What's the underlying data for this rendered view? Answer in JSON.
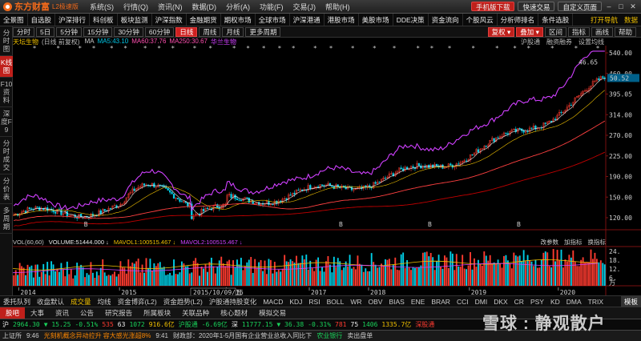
{
  "app": {
    "logo_name": "东方财富",
    "edition": "L2极速版"
  },
  "menu": {
    "items": [
      "系统(S)",
      "行情(Q)",
      "资讯(N)",
      "数据(D)",
      "分析(A)",
      "功能(F)",
      "交易(J)",
      "帮助(H)"
    ]
  },
  "title_right": {
    "mobile": "手机版下载",
    "quick_trade": "快速交易",
    "custom_page": "自定义页面"
  },
  "nav": {
    "items": [
      "全景图",
      "自选股",
      "沪深排行",
      "科创板",
      "板块监测",
      "沪深指数",
      "金融期货",
      "期权市场",
      "全球市场",
      "沪深港通",
      "港股市场",
      "美股市场",
      "DDE决策",
      "资金流向",
      "个股风云",
      "分析师排名",
      "条件选股"
    ],
    "right": [
      "打开导航",
      "数据"
    ]
  },
  "periods": {
    "items": [
      "分时",
      "5日",
      "5分钟",
      "15分钟",
      "30分钟",
      "60分钟",
      "日线",
      "周线",
      "月线",
      "更多周期"
    ],
    "active": "日线"
  },
  "period_right": {
    "red": [
      "复权",
      "叠加"
    ],
    "plain": [
      "区间",
      "指标",
      "画线",
      "帮助"
    ]
  },
  "rail": {
    "items": [
      "分时图",
      "K线图",
      "F10资料",
      "深度F9",
      "分时成交",
      "分价表",
      "多周期"
    ],
    "active": "K线图"
  },
  "chart_head": {
    "symbol": "天坛生物",
    "sub": "(日线 前复权)",
    "mas": [
      {
        "text": "MA",
        "color": "#cccccc"
      },
      {
        "text": "MA5:43.10",
        "color": "#00c8e8"
      },
      {
        "text": "MA60:37.76",
        "color": "#ff4fb0"
      },
      {
        "text": "MA250:30.67",
        "color": "#ff4fb0"
      },
      {
        "text": "华兰生物",
        "color": "#d040ff"
      }
    ],
    "right": [
      "沪股通",
      "融资融券",
      "设置均线"
    ]
  },
  "price_axis": {
    "ticks": [
      "540.00",
      "460.00",
      "395.05",
      "314.00",
      "270.00",
      "225.00",
      "190.00",
      "150.00",
      "120.00"
    ],
    "last": "50.52",
    "annot": "46.65"
  },
  "vol_head": {
    "items": [
      {
        "text": "VOL(60,60)",
        "color": "#cccccc"
      },
      {
        "text": "VOLUME:51444.000 ↓",
        "color": "#eeeeee"
      },
      {
        "text": "MAVOL1:100515.467 ↓",
        "color": "#f0c000"
      },
      {
        "text": "MAVOL2:100515.467 ↓",
        "color": "#d040ff"
      }
    ],
    "right": [
      "改参数",
      "加指标",
      "换指标"
    ]
  },
  "vol_axis": {
    "ticks": [
      "24.",
      "18.",
      "12.",
      "6."
    ],
    "unit": "万"
  },
  "time_axis": {
    "years": [
      "2014",
      "2015",
      "2016",
      "2017",
      "2018",
      "2019",
      "2020"
    ],
    "cursor": "2015/10/09/五"
  },
  "indicator_tabs": {
    "items": [
      "委托队列",
      "收盘默认",
      "成交量",
      "均线",
      "资金博弈(L2)",
      "资金趋势(L2)",
      "沪股通持股变化",
      "MACD",
      "KDJ",
      "RSI",
      "BOLL",
      "WR",
      "OBV",
      "BIAS",
      "ENE",
      "BRAR",
      "CCI",
      "DMI",
      "DKX",
      "CR",
      "PSY",
      "KD",
      "DMA",
      "TRIX"
    ],
    "active": "成交量",
    "template": "模板"
  },
  "news_tabs": {
    "items": [
      "股吧",
      "大事",
      "资讯",
      "公告",
      "研究报告",
      "所属板块",
      "关联品种",
      "核心题材",
      "模拟交易"
    ],
    "active": "股吧"
  },
  "quotes": [
    {
      "text": "沪",
      "color": "#eeeeee"
    },
    {
      "text": "2964.30",
      "color": "#19d25a"
    },
    {
      "text": "▼ 15.25",
      "color": "#19d25a"
    },
    {
      "text": "-0.51%",
      "color": "#19d25a"
    },
    {
      "text": "535",
      "color": "#ff3b30"
    },
    {
      "text": "63",
      "color": "#eeeeee"
    },
    {
      "text": "1072",
      "color": "#19d25a"
    },
    {
      "text": "916.6亿",
      "color": "#f0c000"
    },
    {
      "text": "沪股通",
      "color": "#19d25a"
    },
    {
      "text": "-6.69亿",
      "color": "#19d25a"
    },
    {
      "text": "深",
      "color": "#eeeeee"
    },
    {
      "text": "11777.15",
      "color": "#19d25a"
    },
    {
      "text": "▼ 36.38",
      "color": "#19d25a"
    },
    {
      "text": "-0.31%",
      "color": "#19d25a"
    },
    {
      "text": "781",
      "color": "#ff3b30"
    },
    {
      "text": "75",
      "color": "#eeeeee"
    },
    {
      "text": "1406",
      "color": "#19d25a"
    },
    {
      "text": "1335.7亿",
      "color": "#f0c000"
    },
    {
      "text": "深股通",
      "color": "#ff3b30"
    }
  ],
  "status": {
    "market": "上证所",
    "t1": "9:46",
    "news1": "光刻机概念异动拉升 容大感光涨超8%",
    "t2": "9:41",
    "news2": "财政部：2020年1-5月国有企业营业总收入同比下",
    "stock": "农业银行",
    "action": "卖出盘单"
  },
  "watermark": "雪球 : 静观散户",
  "colors": {
    "accent_red": "#c0201b",
    "logo_orange": "#f26a1b",
    "ma_yellow": "#f0c000",
    "cyan": "#00c8e8",
    "purple": "#d040ff",
    "up_red": "#ff3b30",
    "down_green": "#19d25a"
  }
}
